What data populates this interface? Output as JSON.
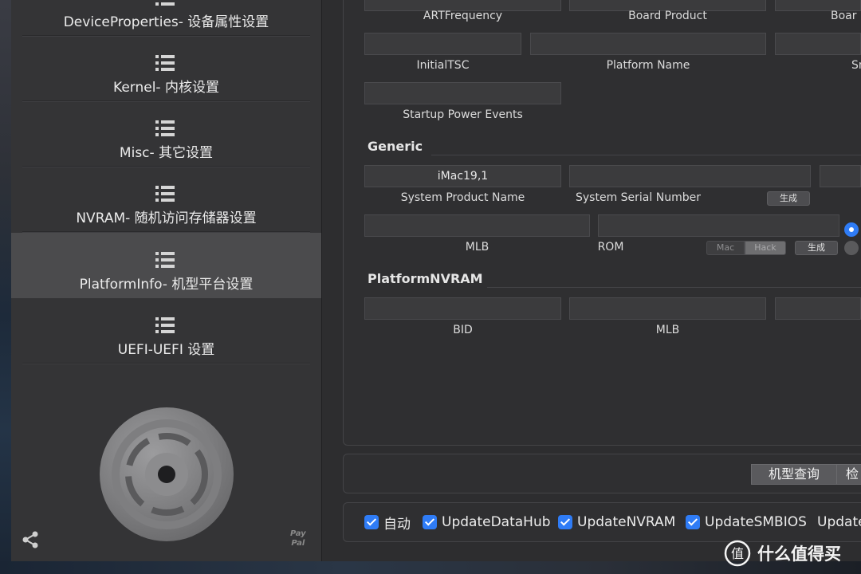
{
  "sidebar": {
    "items": [
      {
        "label": "DeviceProperties- 设备属性设置"
      },
      {
        "label": "Kernel- 内核设置"
      },
      {
        "label": "Misc- 其它设置"
      },
      {
        "label": "NVRAM- 随机访问存储器设置"
      },
      {
        "label": "PlatformInfo- 机型平台设置",
        "active": true
      },
      {
        "label": "UEFI-UEFI 设置"
      }
    ],
    "paypal_line1": "Pay",
    "paypal_line2": "Pal",
    "share_icon": "share-icon",
    "logo_icon": "opencore-disc-icon"
  },
  "datahub": {
    "labels": {
      "art_frequency": "ARTFrequency",
      "board_product": "Board Product",
      "board_cut": "Boar",
      "initial_tsc": "InitialTSC",
      "platform_name": "Platform Name",
      "sm_cut": "Sm",
      "startup_power_events": "Startup Power Events"
    }
  },
  "generic": {
    "title": "Generic",
    "system_product_name_value": "iMac19,1",
    "system_product_name_label": "System Product Name",
    "system_serial_number_label": "System Serial Number",
    "generate_serial_button": "生成",
    "mlb_label": "MLB",
    "rom_label": "ROM",
    "rom_mac_segment": "Mac",
    "rom_hack_segment": "Hack",
    "generate_rom_button": "生成"
  },
  "platform_nvram": {
    "title": "PlatformNVRAM",
    "bid_label": "BID",
    "mlb_label": "MLB"
  },
  "actions": {
    "model_query_button": "机型查询",
    "check_button_cut": "检"
  },
  "options": [
    {
      "label": "自动",
      "checked": true
    },
    {
      "label": "UpdateDataHub",
      "checked": true
    },
    {
      "label": "UpdateNVRAM",
      "checked": true
    },
    {
      "label": "UpdateSMBIOS",
      "checked": true
    },
    {
      "label": "Update",
      "checked": false
    }
  ],
  "watermark": {
    "text": "什么值得买",
    "icon_glyph": "值"
  },
  "colors": {
    "accent": "#2f7cf6",
    "sidebar_active": "#4b4b4d"
  }
}
